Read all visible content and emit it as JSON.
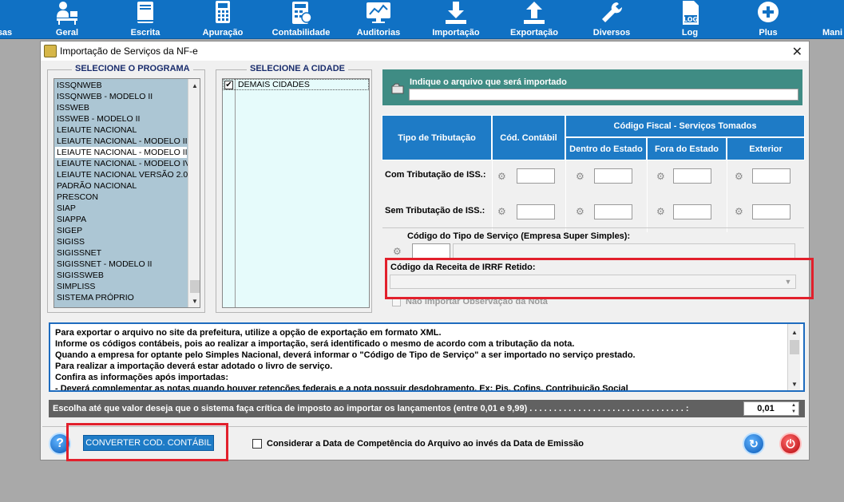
{
  "toolbar": {
    "items": [
      {
        "label": "sas",
        "icon": "partial-icon"
      },
      {
        "label": "Geral",
        "icon": "user-desk-icon"
      },
      {
        "label": "Escrita",
        "icon": "book-icon"
      },
      {
        "label": "Apuração",
        "icon": "calculator-icon"
      },
      {
        "label": "Contabilidade",
        "icon": "accounting-calc-icon"
      },
      {
        "label": "Auditorias",
        "icon": "monitor-chart-icon"
      },
      {
        "label": "Importação",
        "icon": "download-icon"
      },
      {
        "label": "Exportação",
        "icon": "upload-icon"
      },
      {
        "label": "Diversos",
        "icon": "wrench-icon"
      },
      {
        "label": "Log",
        "icon": "log-file-icon"
      },
      {
        "label": "Plus",
        "icon": "plus-circle-icon"
      },
      {
        "label": "Mani",
        "icon": "partial-icon"
      }
    ]
  },
  "dialog": {
    "title": "Importação de Serviços da NF-e",
    "programs_label": "SELECIONE O PROGRAMA",
    "programs": [
      "ISSQNWEB",
      "ISSQNWEB - MODELO II",
      "ISSWEB",
      "ISSWEB - MODELO II",
      "LEIAUTE NACIONAL",
      "LEIAUTE NACIONAL - MODELO II",
      "LEIAUTE NACIONAL - MODELO III",
      "LEIAUTE NACIONAL - MODELO IV",
      "LEIAUTE NACIONAL VERSÃO 2.0",
      "PADRÃO NACIONAL",
      "PRESCON",
      "SIAP",
      "SIAPPA",
      "SIGEP",
      "SIGISS",
      "SIGISSNET",
      "SIGISSNET - MODELO II",
      "SIGISSWEB",
      "SIMPLISS",
      "SISTEMA PRÓPRIO"
    ],
    "selected_program": "LEIAUTE NACIONAL - MODELO III",
    "city_label": "SELECIONE A CIDADE",
    "cities": [
      "DEMAIS CIDADES"
    ],
    "file_label": "Indique o arquivo que será importado",
    "file_value": "",
    "table": {
      "col_tributacao": "Tipo de Tributação",
      "col_contabil": "Cód. Contábil",
      "col_fiscal": "Código Fiscal - Serviços Tomados",
      "col_dentro": "Dentro do Estado",
      "col_fora": "Fora do Estado",
      "col_exterior": "Exterior",
      "row_com": "Com Tributação de ISS.:",
      "row_sem": "Sem Tributação de ISS.:"
    },
    "servico_label": "Código do Tipo de Serviço (Empresa Super Simples):",
    "irrf_label": "Código da Receita de IRRF Retido:",
    "irrf_value": "",
    "nao_importar_label": "Não importar Observação da Nota",
    "info_lines": [
      "Para exportar o arquivo no site da prefeitura, utilize a opção de exportação em formato XML.",
      "Informe os códigos contábeis, pois ao realizar a importação, será identificado o mesmo de acordo com a tributação da nota.",
      "Quando a empresa for optante pelo Simples Nacional, deverá informar o \"Código de Tipo de Serviço\" a ser importado no serviço prestado.",
      "Para realizar a importação deverá estar adotado o livro de serviço.",
      "Confira as informações após importadas:",
      "  - Deverá complementar as notas quando houver retenções federais e a nota possuir desdobramento. Ex: Pis, Cofins, Contribuição Social"
    ],
    "critica_label": "Escolha até que valor deseja que o sistema faça crítica de imposto ao importar os lançamentos (entre 0,01 e 9,99) . . . . . . . . . . . . . . . . . . . . . . . . . . . . . . . . :",
    "critica_value": "0,01",
    "converter_label": "CONVERTER COD. CONTÁBIL",
    "competencia_label": "Considerar a Data de Competência do Arquivo ao invés da Data de Emissão"
  },
  "colors": {
    "toolbar": "#1071c4",
    "header": "#1e7bc6",
    "file_panel": "#3f8c84",
    "highlight": "#e2202c",
    "list_bg": "#acc6d4"
  }
}
